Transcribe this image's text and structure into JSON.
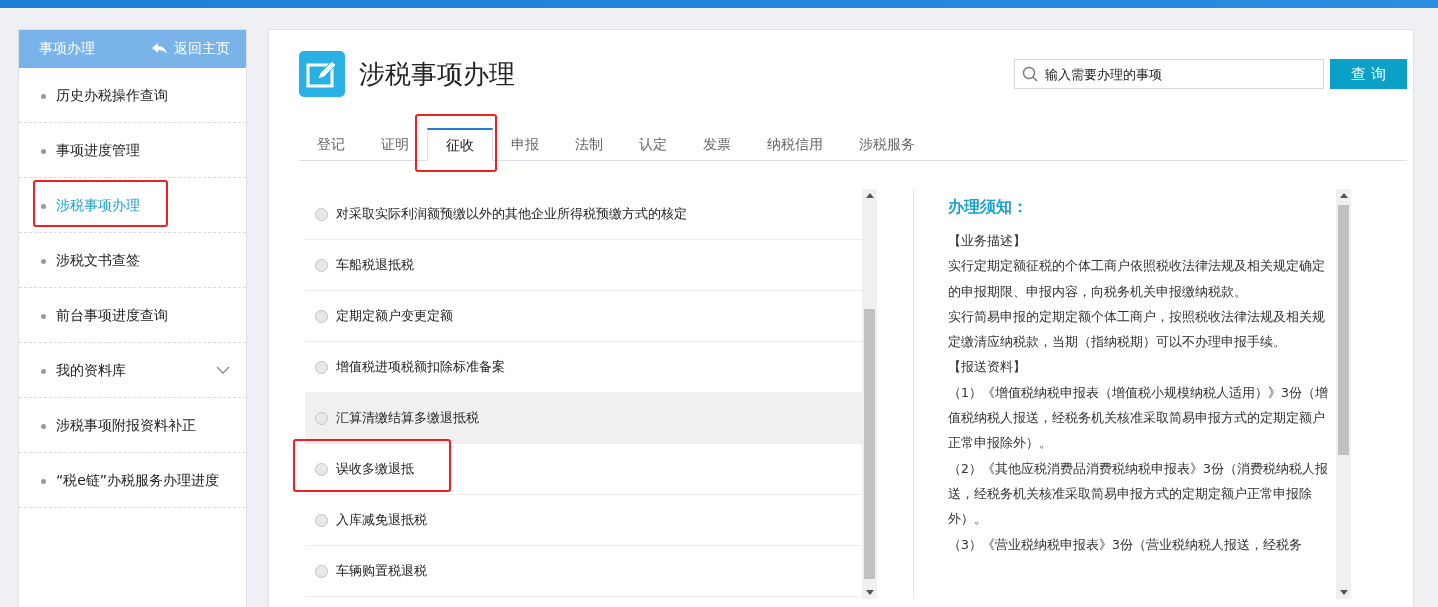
{
  "sidebar": {
    "title": "事项办理",
    "back_link": "返回主页",
    "items": [
      {
        "label": "历史办税操作查询",
        "selected": false,
        "highlighted": false
      },
      {
        "label": "事项进度管理",
        "selected": false,
        "highlighted": false
      },
      {
        "label": "涉税事项办理",
        "selected": true,
        "highlighted": true
      },
      {
        "label": "涉税文书查签",
        "selected": false,
        "highlighted": false
      },
      {
        "label": "前台事项进度查询",
        "selected": false,
        "highlighted": false
      },
      {
        "label": "我的资料库",
        "selected": false,
        "highlighted": false,
        "expandable": true
      },
      {
        "label": "涉税事项附报资料补正",
        "selected": false,
        "highlighted": false
      },
      {
        "label": "“税e链”办税服务办理进度",
        "selected": false,
        "highlighted": false
      }
    ]
  },
  "page_title": "涉税事项办理",
  "search": {
    "placeholder": "输入需要办理的事项",
    "button": "查 询"
  },
  "tabs": [
    {
      "label": "登记",
      "selected": false,
      "highlighted": false
    },
    {
      "label": "证明",
      "selected": false,
      "highlighted": false
    },
    {
      "label": "征收",
      "selected": true,
      "highlighted": true
    },
    {
      "label": "申报",
      "selected": false,
      "highlighted": false
    },
    {
      "label": "法制",
      "selected": false,
      "highlighted": false
    },
    {
      "label": "认定",
      "selected": false,
      "highlighted": false
    },
    {
      "label": "发票",
      "selected": false,
      "highlighted": false
    },
    {
      "label": "纳税信用",
      "selected": false,
      "highlighted": false
    },
    {
      "label": "涉税服务",
      "selected": false,
      "highlighted": false
    }
  ],
  "matters": [
    {
      "label": "对采取实际利润额预缴以外的其他企业所得税预缴方式的核定",
      "selected": false,
      "hovered": false,
      "highlighted": false
    },
    {
      "label": "车船税退抵税",
      "selected": false,
      "hovered": false,
      "highlighted": false
    },
    {
      "label": "定期定额户变更定额",
      "selected": false,
      "hovered": false,
      "highlighted": false
    },
    {
      "label": "增值税进项税额扣除标准备案",
      "selected": false,
      "hovered": false,
      "highlighted": false
    },
    {
      "label": "汇算清缴结算多缴退抵税",
      "selected": false,
      "hovered": true,
      "highlighted": false
    },
    {
      "label": "误收多缴退抵",
      "selected": false,
      "hovered": false,
      "highlighted": true
    },
    {
      "label": "入库减免退抵税",
      "selected": false,
      "hovered": false,
      "highlighted": false
    },
    {
      "label": "车辆购置税退税",
      "selected": false,
      "hovered": false,
      "highlighted": false
    }
  ],
  "notice": {
    "title": "办理须知：",
    "paragraphs": [
      "【业务描述】",
      "实行定期定额征税的个体工商户依照税收法律法规及相关规定确定的申报期限、申报内容，向税务机关申报缴纳税款。",
      "实行简易申报的定期定额个体工商户，按照税收法律法规及相关规定缴清应纳税款，当期（指纳税期）可以不办理申报手续。",
      "【报送资料】",
      "（1）《增值税纳税申报表（增值税小规模纳税人适用）》3份（增值税纳税人报送，经税务机关核准采取简易申报方式的定期定额户正常申报除外）。",
      "（2）《其他应税消费品消费税纳税申报表》3份（消费税纳税人报送，经税务机关核准采取简易申报方式的定期定额户正常申报除外）。",
      "（3）《营业税纳税申报表》3份（营业税纳税人报送，经税务"
    ]
  }
}
